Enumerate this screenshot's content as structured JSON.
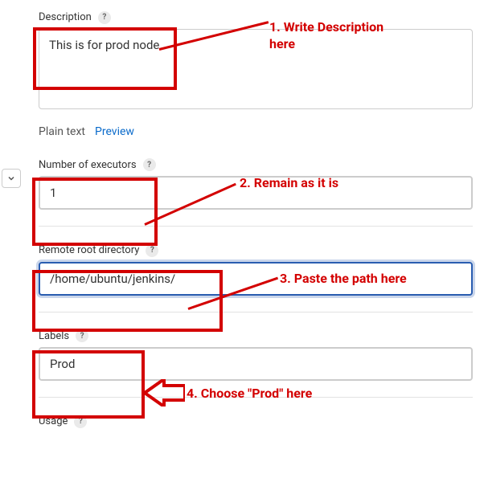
{
  "fields": {
    "description": {
      "label": "Description",
      "value": "This is for prod node."
    },
    "tabs": {
      "plain": "Plain text",
      "preview": "Preview"
    },
    "executors": {
      "label": "Number of executors",
      "value": "1"
    },
    "remote_root": {
      "label": "Remote root directory",
      "value": "/home/ubuntu/jenkins/"
    },
    "labels": {
      "label": "Labels",
      "value": "Prod"
    },
    "usage": {
      "label": "Usage"
    }
  },
  "annotations": {
    "a1_line1": "1. Write Description",
    "a1_line2": "here",
    "a2": "2. Remain as it is",
    "a3": "3. Paste the path here",
    "a4": "4. Choose \"Prod\" here"
  },
  "icons": {
    "help": "?"
  }
}
